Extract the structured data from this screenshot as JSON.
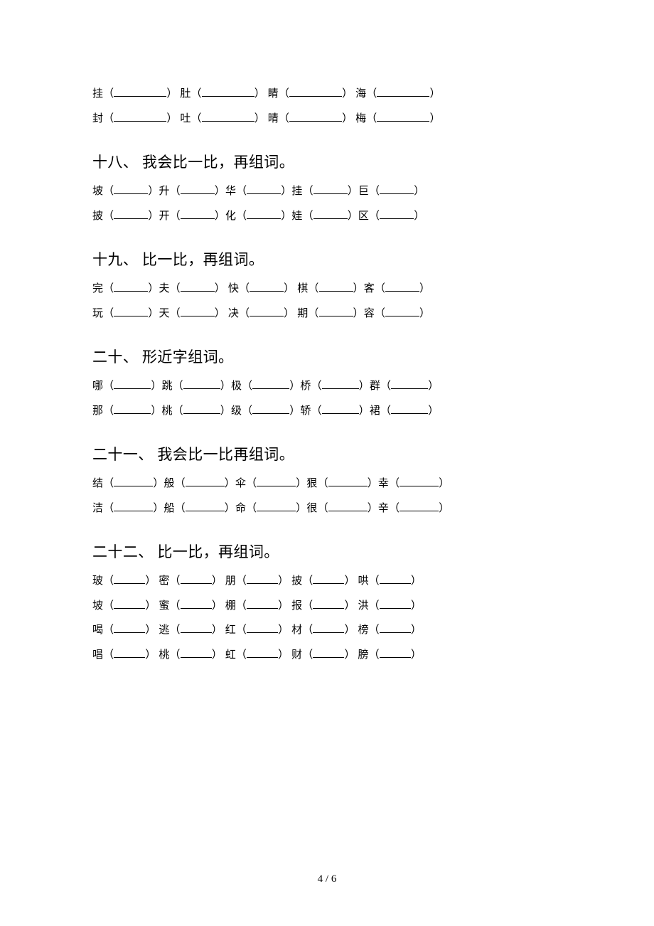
{
  "top_rows": [
    [
      "挂",
      "肚",
      "睛",
      "海"
    ],
    [
      "封",
      "吐",
      "晴",
      "梅"
    ]
  ],
  "sections": [
    {
      "heading": "十八、 我会比一比，再组词。",
      "rows": [
        [
          "坡",
          "升",
          "华",
          "挂",
          "巨"
        ],
        [
          "披",
          "开",
          "化",
          "娃",
          "区"
        ]
      ],
      "blank_class": "blank-short"
    },
    {
      "heading": "十九、 比一比，再组词。",
      "rows": [
        [
          "完",
          "夫",
          "快",
          "棋",
          "客"
        ],
        [
          "玩",
          "天",
          "决",
          "期",
          "容"
        ]
      ],
      "blank_class": "blank-short"
    },
    {
      "heading": "二十、 形近字组词。",
      "rows": [
        [
          "哪",
          "跳",
          "极",
          "桥",
          "群"
        ],
        [
          "那",
          "桃",
          "级",
          "轿",
          "裙"
        ]
      ],
      "blank_class": "blank-med"
    },
    {
      "heading": "二十一、 我会比一比再组词。",
      "rows": [
        [
          "结",
          "般",
          "伞",
          "狠",
          "幸"
        ],
        [
          "洁",
          "船",
          "命",
          "很",
          "辛"
        ]
      ],
      "blank_class": "blank-medl"
    },
    {
      "heading": "二十二、 比一比，再组词。",
      "rows": [
        [
          "玻",
          "密",
          "朋",
          "披",
          "哄"
        ],
        [
          "坡",
          "蜜",
          "棚",
          "报",
          "洪"
        ],
        [
          "喝",
          "逃",
          "红",
          "材",
          "榜"
        ],
        [
          "唱",
          "桃",
          "虹",
          "财",
          "膀"
        ]
      ],
      "blank_class": "blank-sm"
    }
  ],
  "page_number": "4 / 6"
}
